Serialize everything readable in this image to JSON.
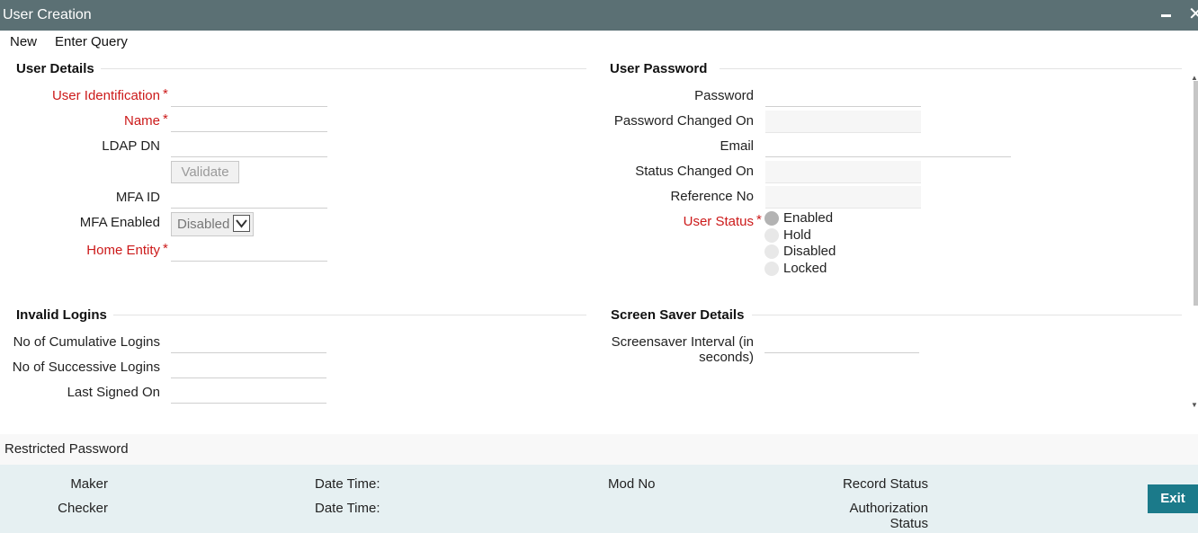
{
  "window": {
    "title": "User Creation",
    "minimize_icon": "minimize-icon",
    "close_icon": "close-icon",
    "close_glyph": "✕"
  },
  "menu": {
    "new": "New",
    "enter_query": "Enter Query"
  },
  "user_details": {
    "title": "User Details",
    "user_identification": "User Identification",
    "name": "Name",
    "ldap_dn": "LDAP DN",
    "validate": "Validate",
    "mfa_id": "MFA ID",
    "mfa_enabled": "MFA Enabled",
    "mfa_enabled_value": "Disabled",
    "home_entity": "Home Entity",
    "required_mark": "*"
  },
  "user_password": {
    "title": "User Password",
    "password": "Password",
    "password_changed_on": "Password Changed On",
    "email": "Email",
    "status_changed_on": "Status Changed On",
    "reference_no": "Reference No",
    "user_status": "User Status",
    "required_mark": "*",
    "status_options": [
      "Enabled",
      "Hold",
      "Disabled",
      "Locked"
    ],
    "selected_status": "Enabled"
  },
  "invalid_logins": {
    "title": "Invalid Logins",
    "cumulative": "No of Cumulative Logins",
    "successive": "No of Successive Logins",
    "last_signed_on": "Last Signed On"
  },
  "screen_saver": {
    "title": "Screen Saver Details",
    "interval_line1": "Screensaver Interval (in",
    "interval_line2": "seconds)"
  },
  "restricted_password": "Restricted Password",
  "footer": {
    "maker": "Maker",
    "checker": "Checker",
    "date_time_1": "Date Time:",
    "date_time_2": "Date Time:",
    "mod_no": "Mod No",
    "record_status": "Record Status",
    "authorization_line1": "Authorization",
    "authorization_line2": "Status",
    "exit": "Exit"
  },
  "colors": {
    "titlebar": "#5b7074",
    "required": "#cc1a1a",
    "footer_bg": "#e6f0f2",
    "exit_bg": "#1b7a8a"
  }
}
